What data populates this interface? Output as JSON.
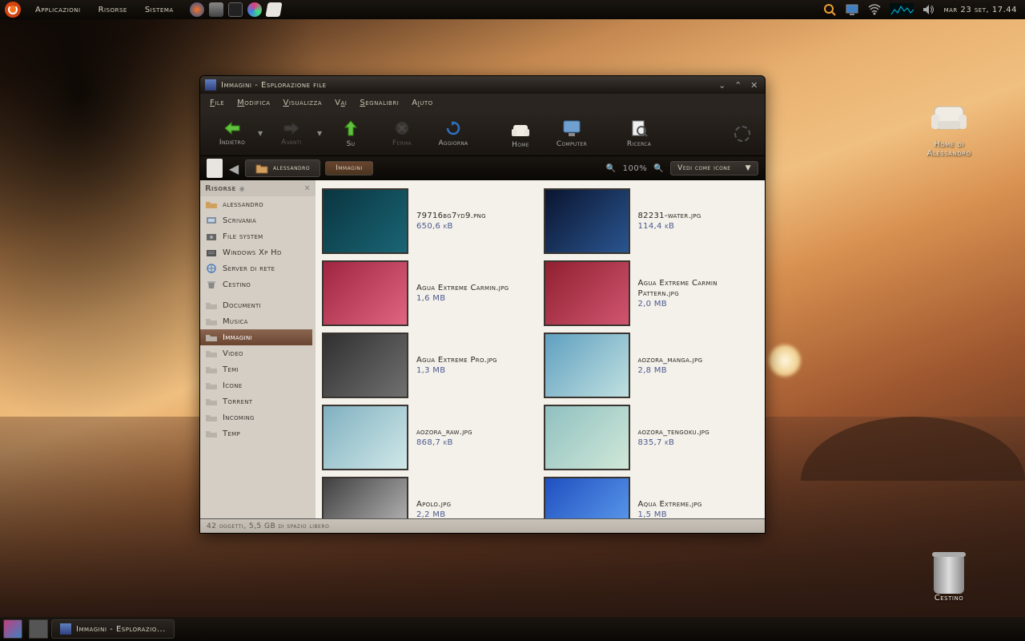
{
  "panel": {
    "menus": [
      "Applicazioni",
      "Risorse",
      "Sistema"
    ],
    "clock": "mar 23 set, 17.44"
  },
  "desktop": {
    "home_label": "Home di Alessandro",
    "trash_label": "Cestino"
  },
  "taskbar": {
    "task1": "Immagini - Esplorazio..."
  },
  "window": {
    "title": "Immagini - Esplorazione file",
    "menus": {
      "file": "File",
      "modifica": "Modifica",
      "visualizza": "Visualizza",
      "vai": "Vai",
      "segnalibri": "Segnalibri",
      "aiuto": "Aiuto"
    },
    "toolbar": {
      "back": "Indietro",
      "forward": "Avanti",
      "up": "Su",
      "stop": "Ferma",
      "reload": "Aggiorna",
      "home": "Home",
      "computer": "Computer",
      "search": "Ricerca"
    },
    "crumb1": "alessandro",
    "crumb2": "Immagini",
    "zoom": "100%",
    "view_label": "Vedi come icone",
    "status": "42 oggetti, 5,5 GB di spazio libero"
  },
  "sidebar": {
    "title": "Risorse",
    "items": [
      {
        "label": "alessandro"
      },
      {
        "label": "Scrivania"
      },
      {
        "label": "File system"
      },
      {
        "label": "Windows Xp Hd"
      },
      {
        "label": "Server di rete"
      },
      {
        "label": "Cestino"
      }
    ],
    "folders": [
      {
        "label": "Documenti"
      },
      {
        "label": "Musica"
      },
      {
        "label": "Immagini"
      },
      {
        "label": "Video"
      },
      {
        "label": "Temi"
      },
      {
        "label": "Icone"
      },
      {
        "label": "Torrent"
      },
      {
        "label": "Incoming"
      },
      {
        "label": "Temp"
      }
    ]
  },
  "files": [
    {
      "name": "79716bg7yd9.png",
      "size": "650,6 kB",
      "bg": "linear-gradient(135deg,#0a3540,#1a6575)"
    },
    {
      "name": "82231-water.jpg",
      "size": "114,4 kB",
      "bg": "linear-gradient(135deg,#0a1530,#2a5590)"
    },
    {
      "name": "Agua Extreme Carmin.jpg",
      "size": "1,6 MB",
      "bg": "linear-gradient(135deg,#a02540,#e06580)"
    },
    {
      "name": "Agua Extreme Carmin Pattern.jpg",
      "size": "2,0 MB",
      "bg": "linear-gradient(135deg,#902030,#d05570)"
    },
    {
      "name": "Agua Extreme Pro.jpg",
      "size": "1,3 MB",
      "bg": "linear-gradient(135deg,#303030,#707070)"
    },
    {
      "name": "aozora_manga.jpg",
      "size": "2,8 MB",
      "bg": "linear-gradient(135deg,#60a0c0,#c0e0e0)"
    },
    {
      "name": "aozora_raw.jpg",
      "size": "868,7 kB",
      "bg": "linear-gradient(135deg,#80b0c0,#d0e8e8)"
    },
    {
      "name": "aozora_tengoku.jpg",
      "size": "835,7 kB",
      "bg": "linear-gradient(135deg,#90c0c0,#d0e8d8)"
    },
    {
      "name": "Apolo.jpg",
      "size": "2,2 MB",
      "bg": "linear-gradient(135deg,#404040,#c0c0c0)"
    },
    {
      "name": "Aqua Extreme.jpg",
      "size": "1,5 MB",
      "bg": "linear-gradient(135deg,#2050c0,#60a0f0)"
    }
  ]
}
